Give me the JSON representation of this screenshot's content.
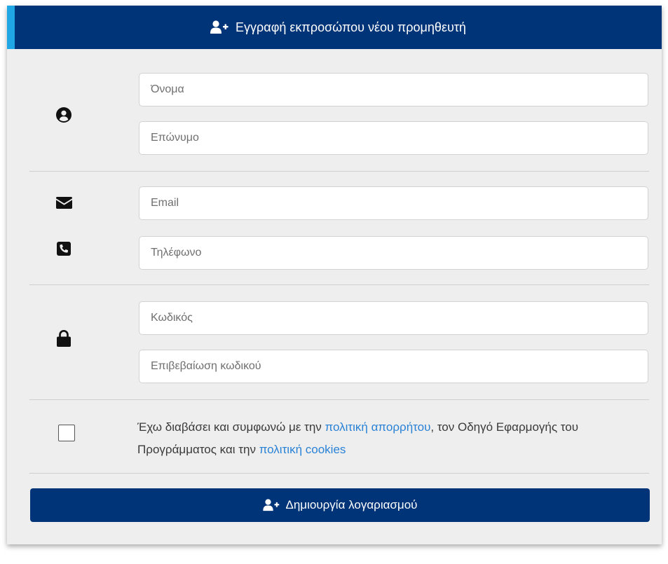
{
  "form": {
    "title": "Εγγραφή εκπροσώπου νέου προμηθευτή",
    "fields": {
      "first_name": {
        "placeholder": "Όνομα",
        "value": ""
      },
      "last_name": {
        "placeholder": "Επώνυμο",
        "value": ""
      },
      "email": {
        "placeholder": "Email",
        "value": ""
      },
      "phone": {
        "placeholder": "Τηλέφωνο",
        "value": ""
      },
      "password": {
        "placeholder": "Κωδικός",
        "value": ""
      },
      "password_confirm": {
        "placeholder": "Επιβεβαίωση κωδικού",
        "value": ""
      }
    },
    "icons": {
      "header": "user-plus-icon",
      "name_section": "user-circle-icon",
      "email": "envelope-icon",
      "phone": "phone-square-icon",
      "password": "lock-icon",
      "submit": "user-plus-icon"
    },
    "consent": {
      "checked": false,
      "text_before": "Έχω διαβάσει και συμφωνώ με την ",
      "privacy_link": "πολιτική απορρήτου",
      "text_middle": ", τον Οδηγό Εφαρμογής του Προγράμματος και την ",
      "cookies_link": "πολιτική cookies"
    },
    "submit_label": "Δημιουργία λογαριασμού"
  },
  "colors": {
    "header_bg": "#003478",
    "header_accent": "#1ea7e4",
    "card_bg": "#eeeeee",
    "link": "#2a82d6",
    "button_bg": "#003478"
  }
}
